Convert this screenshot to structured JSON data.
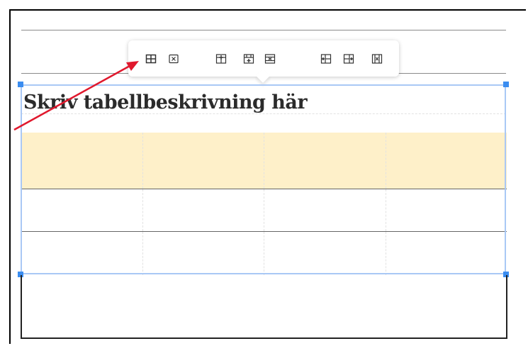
{
  "caption": {
    "text": "Skriv tabellbeskrivning här"
  },
  "toolbar": {
    "buttons": [
      {
        "name": "table-properties-icon"
      },
      {
        "name": "delete-table-icon"
      },
      {
        "name": "insert-row-above-icon"
      },
      {
        "name": "insert-row-below-icon"
      },
      {
        "name": "delete-row-icon"
      },
      {
        "name": "insert-column-left-icon"
      },
      {
        "name": "insert-column-right-icon"
      },
      {
        "name": "delete-column-icon"
      }
    ]
  },
  "table": {
    "columns": 4,
    "rows": [
      {
        "type": "header",
        "cells": [
          "",
          "",
          "",
          ""
        ]
      },
      {
        "type": "body",
        "cells": [
          "",
          "",
          "",
          ""
        ]
      },
      {
        "type": "body",
        "cells": [
          "",
          "",
          "",
          ""
        ]
      }
    ]
  },
  "colors": {
    "header_row": "#fef0c9",
    "selection": "#a9c8f5",
    "handle": "#3b8df0",
    "arrow": "#e0182d"
  }
}
